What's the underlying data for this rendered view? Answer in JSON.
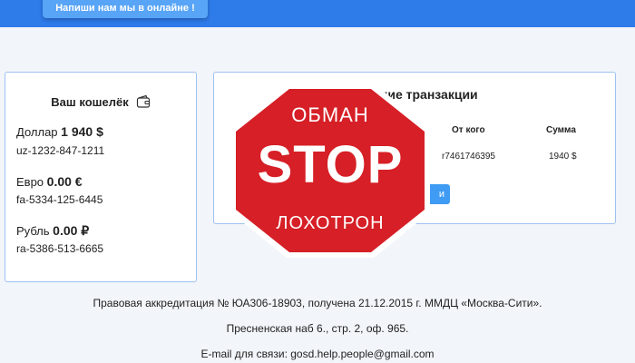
{
  "header": {
    "chat_button_label": "Напиши нам мы в онлайне !"
  },
  "wallet": {
    "title": "Ваш кошелёк",
    "icon": "wallet-icon",
    "currencies": [
      {
        "name": "Доллар",
        "amount": "1 940 $",
        "account": "uz-1232-847-1211"
      },
      {
        "name": "Евро",
        "amount": "0.00 €",
        "account": "fa-5334-125-6445"
      },
      {
        "name": "Рубль",
        "amount": "0.00 ₽",
        "account": "ra-5386-513-6665"
      }
    ]
  },
  "transactions": {
    "title_visible": "дние транзакции",
    "columns": {
      "from": "От кого",
      "sum": "Сумма"
    },
    "rows": [
      {
        "from": "r7461746395",
        "sum": "1940 $"
      }
    ],
    "more_button_visible": "и"
  },
  "overlay": {
    "icon": "stop-sign-icon",
    "top": "ОБМАН",
    "middle": "STOP",
    "bottom": "ЛОХОТРОН",
    "color_red": "#d61f26"
  },
  "footer": {
    "line1": "Правовая аккредитация № ЮА306-18903, получена 21.12.2015 г. ММДЦ «Москва-Сити».",
    "line2": "Пресненская наб 6., стр. 2, оф. 965.",
    "line3": "E-mail для связи: gosd.help.people@gmail.com"
  }
}
